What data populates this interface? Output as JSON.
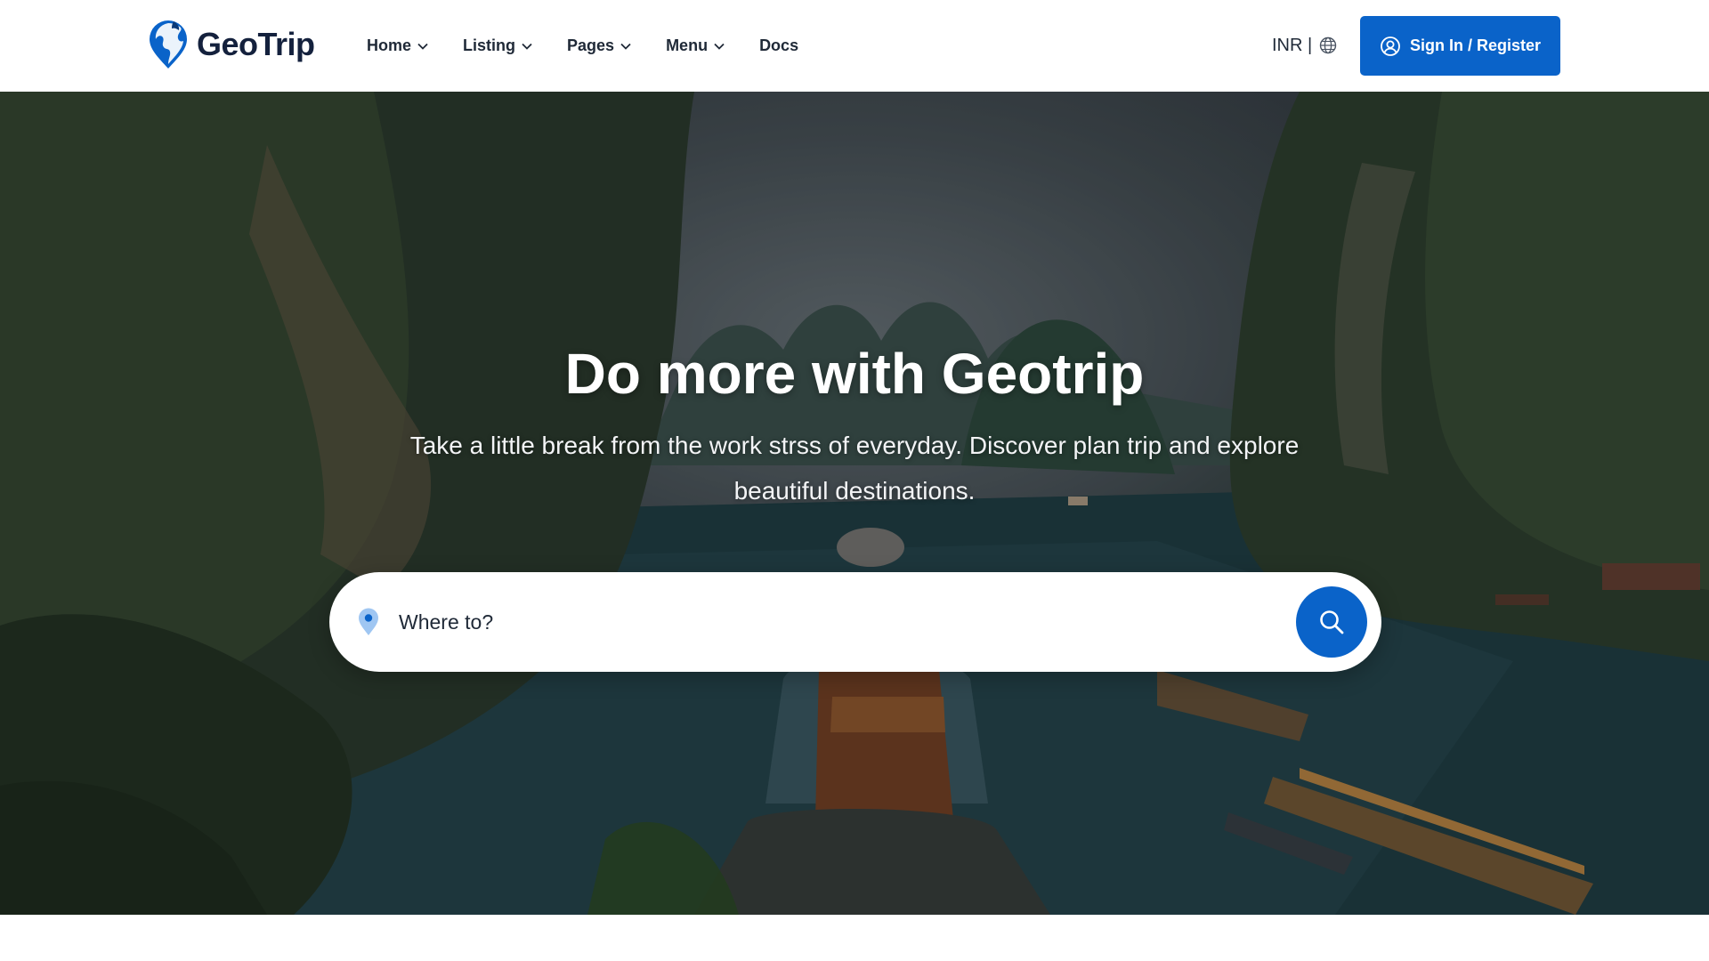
{
  "brand": {
    "name": "GeoTrip",
    "logo_icon": "globe-pin-logo-icon",
    "logo_color": "#0a63c9",
    "text_color": "#14213d"
  },
  "nav": {
    "items": [
      {
        "label": "Home",
        "has_dropdown": true
      },
      {
        "label": "Listing",
        "has_dropdown": true
      },
      {
        "label": "Pages",
        "has_dropdown": true
      },
      {
        "label": "Menu",
        "has_dropdown": true
      },
      {
        "label": "Docs",
        "has_dropdown": false
      }
    ]
  },
  "currency": {
    "label": "INR |",
    "icon": "globe-icon"
  },
  "auth": {
    "label": "Sign In / Register",
    "icon": "user-circle-icon",
    "accent": "#0a63c9"
  },
  "hero": {
    "title": "Do more with Geotrip",
    "subtitle": "Take a little break from the work strss of everyday. Discover plan trip and explore beautiful destinations.",
    "background": "photo of a backpacker overlooking a river between limestone cliffs with long-tail boats"
  },
  "search": {
    "placeholder": "Where to?",
    "value": "",
    "location_icon": "map-pin-icon",
    "button_icon": "search-icon"
  }
}
